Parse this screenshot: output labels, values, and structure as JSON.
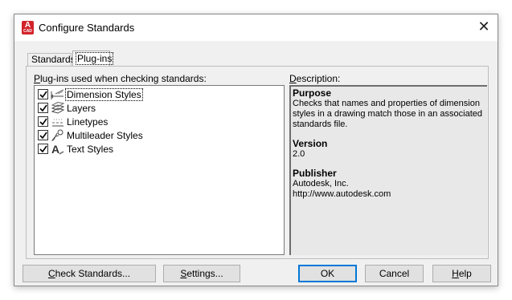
{
  "window": {
    "title": "Configure Standards",
    "app_icon_letter": "A",
    "app_icon_sub": "CAD",
    "close_glyph": "✕"
  },
  "tabs": [
    {
      "label": "Standards",
      "active": false
    },
    {
      "label": "Plug-ins",
      "active": true
    }
  ],
  "plugins": {
    "label_prefix": "P",
    "label_rest": "lug-ins used when checking standards:",
    "items": [
      {
        "label": "Dimension Styles",
        "checked": true,
        "icon": "dimension-styles-icon"
      },
      {
        "label": "Layers",
        "checked": true,
        "icon": "layers-icon"
      },
      {
        "label": "Linetypes",
        "checked": true,
        "icon": "linetypes-icon"
      },
      {
        "label": "Multileader Styles",
        "checked": true,
        "icon": "multileader-styles-icon"
      },
      {
        "label": "Text Styles",
        "checked": true,
        "icon": "text-styles-icon"
      }
    ]
  },
  "description": {
    "label_prefix": "D",
    "label_rest": "escription:",
    "purpose_heading": "Purpose",
    "purpose_text": "Checks that names and properties of dimension styles in a drawing match those in an associated standards file.",
    "version_heading": "Version",
    "version_text": "2.0",
    "publisher_heading": "Publisher",
    "publisher_name": "Autodesk, Inc.",
    "publisher_url": "http://www.autodesk.com"
  },
  "buttons": {
    "check_prefix": "C",
    "check_rest": "heck Standards...",
    "settings_prefix": "S",
    "settings_rest": "ettings...",
    "ok": "OK",
    "cancel": "Cancel",
    "help_prefix": "H",
    "help_rest": "elp"
  },
  "colors": {
    "accent": "#0078d7",
    "app_icon": "#d2232a"
  }
}
